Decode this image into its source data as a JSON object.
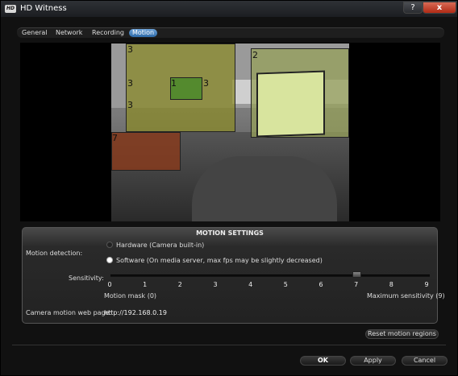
{
  "window": {
    "title": "HD Witness",
    "app_icon": "HD",
    "help": "?",
    "close": "x"
  },
  "tabs": [
    {
      "label": "General"
    },
    {
      "label": "Network"
    },
    {
      "label": "Recording"
    },
    {
      "label": "Motion",
      "active": true
    }
  ],
  "regions": [
    {
      "num": "3",
      "color": "#8a8a2a"
    },
    {
      "num": "3",
      "color": "#8a8a2a"
    },
    {
      "num": "3",
      "color": "#8a8a2a"
    },
    {
      "num": "3",
      "color": "#8a8a2a"
    },
    {
      "num": "1",
      "color": "#4a8a2a"
    },
    {
      "num": "2",
      "color": "#c8d890"
    },
    {
      "num": "7",
      "color": "#8a3a1a"
    }
  ],
  "settings": {
    "header": "MOTION SETTINGS",
    "detection_label": "Motion detection:",
    "option_hardware": "Hardware (Camera built-in)",
    "option_software": "Software (On media server, max fps may be slightly decreased)",
    "selected_option": "software",
    "sensitivity_label": "Sensitivity:",
    "sensitivity_value": 7,
    "ticks": [
      "0",
      "1",
      "2",
      "3",
      "4",
      "5",
      "6",
      "7",
      "8",
      "9"
    ],
    "min_caption": "Motion mask (0)",
    "max_caption": "Maximum sensitivity (9)",
    "web_page_label": "Camera motion web page:",
    "web_page_url": "http://192.168.0.19"
  },
  "buttons": {
    "reset": "Reset motion regions",
    "ok": "OK",
    "apply": "Apply",
    "cancel": "Cancel"
  }
}
